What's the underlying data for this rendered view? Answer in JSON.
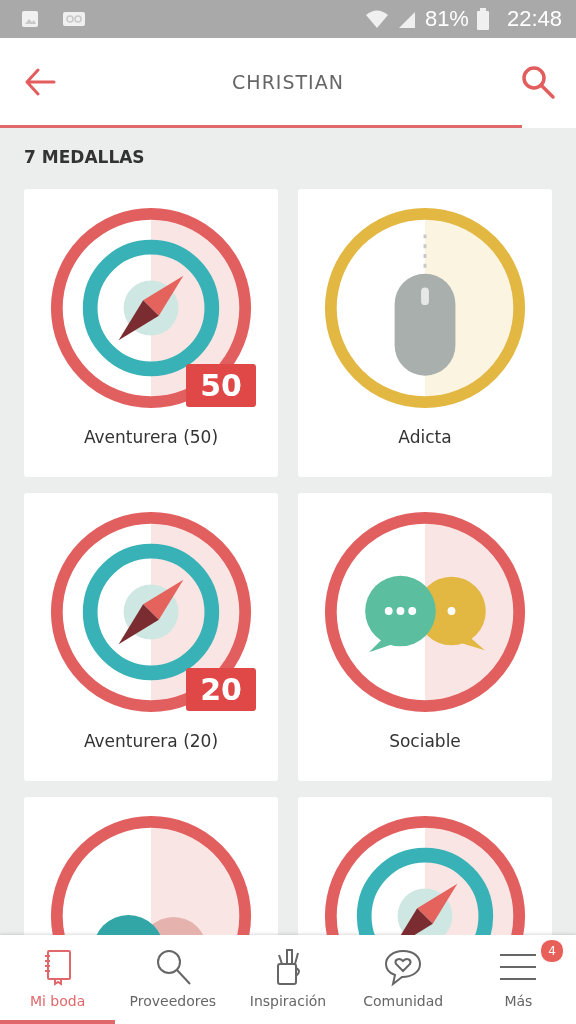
{
  "status_bar": {
    "battery": "81%",
    "time": "22:48"
  },
  "header": {
    "title": "CHRISTIAN"
  },
  "section_title": "7 MEDALLAS",
  "medals": [
    {
      "kind": "compass",
      "color": "#e25f5f",
      "label": "Aventurera (50)",
      "badge": "50"
    },
    {
      "kind": "mouse",
      "color": "#e2b843",
      "label": "Adicta"
    },
    {
      "kind": "compass",
      "color": "#e25f5f",
      "label": "Aventurera (20)",
      "badge": "20"
    },
    {
      "kind": "chat",
      "color": "#e25f5f",
      "label": "Sociable"
    },
    {
      "kind": "smiley",
      "color": "#e25f5f"
    },
    {
      "kind": "compass",
      "color": "#e25f5f"
    }
  ],
  "bottom_nav": [
    {
      "kind": "notebook",
      "label": "Mi boda",
      "selected": true
    },
    {
      "kind": "search",
      "label": "Proveedores",
      "selected": false
    },
    {
      "kind": "mug",
      "label": "Inspiración",
      "selected": false
    },
    {
      "kind": "heart-bubble",
      "label": "Comunidad",
      "selected": false
    },
    {
      "kind": "menu",
      "label": "Más",
      "selected": false,
      "badge": "4"
    }
  ]
}
